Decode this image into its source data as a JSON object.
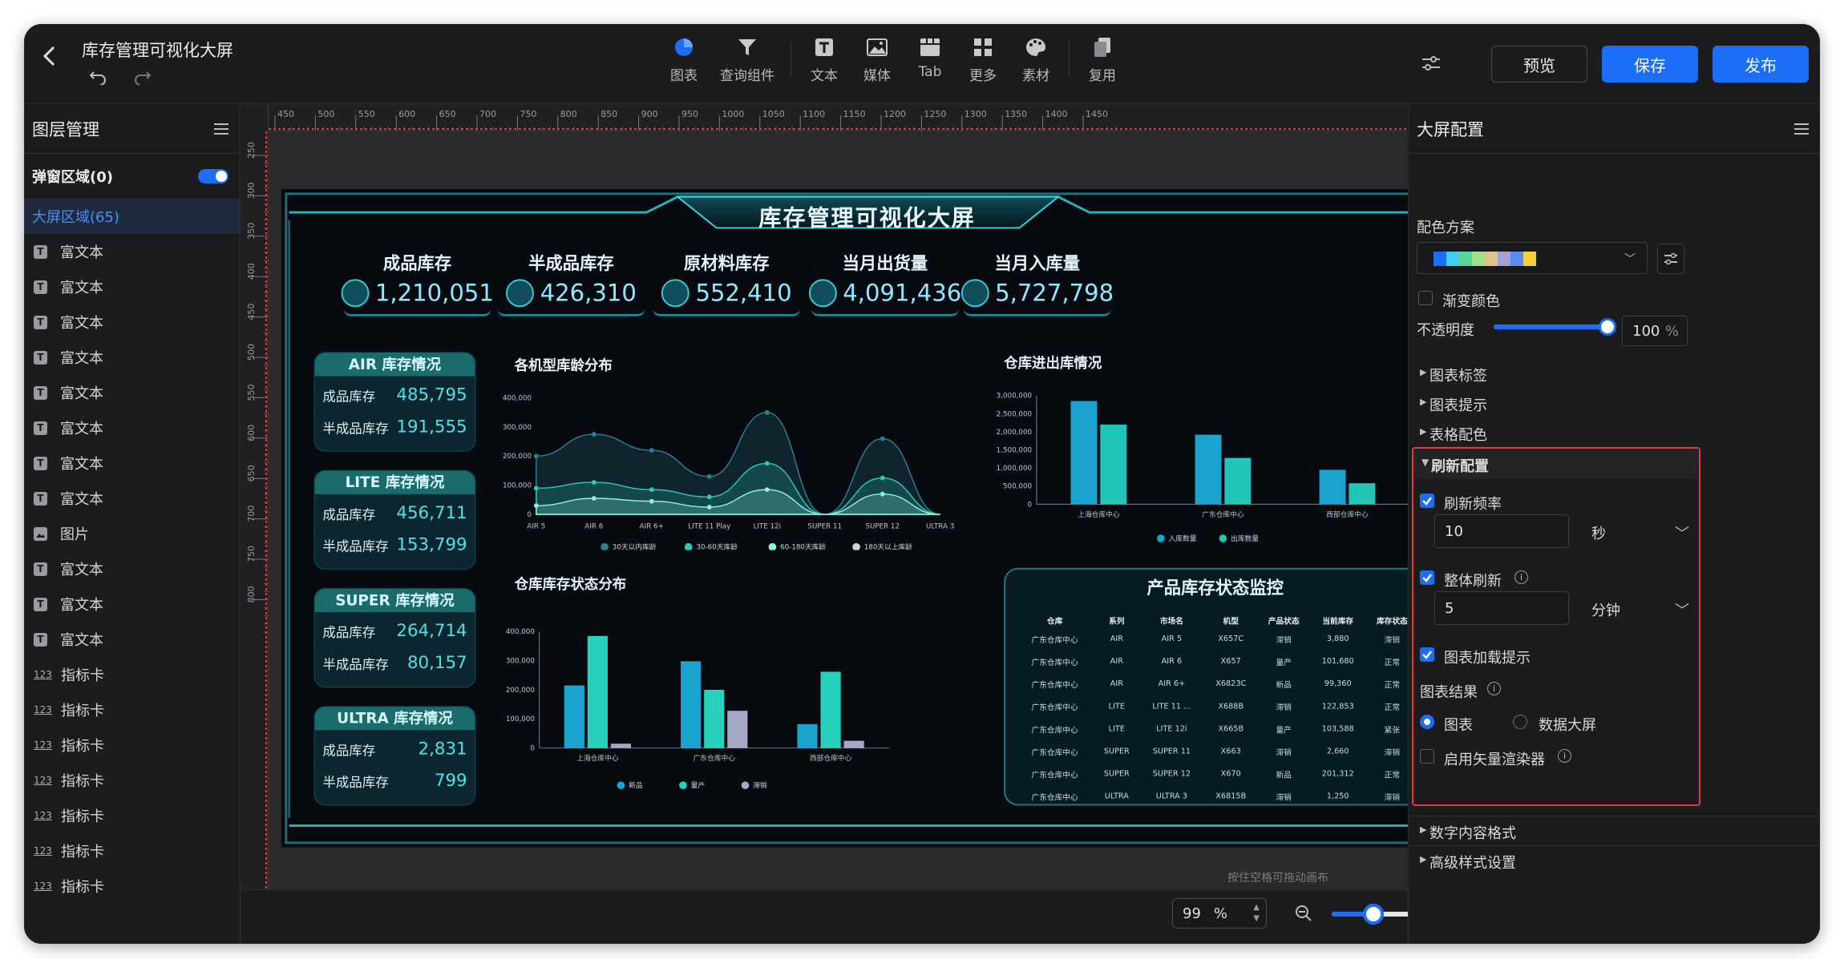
{
  "header": {
    "title": "库存管理可视化大屏",
    "tools": [
      {
        "label": "图表",
        "icon": "pie-chart-icon"
      },
      {
        "label": "查询组件",
        "icon": "filter-icon"
      },
      {
        "label": "文本",
        "icon": "text-icon"
      },
      {
        "label": "媒体",
        "icon": "image-icon"
      },
      {
        "label": "Tab",
        "icon": "tab-icon"
      },
      {
        "label": "更多",
        "icon": "grid-icon"
      },
      {
        "label": "素材",
        "icon": "palette-icon"
      },
      {
        "label": "复用",
        "icon": "copy-icon"
      }
    ],
    "preview": "预览",
    "save": "保存",
    "publish": "发布"
  },
  "layers": {
    "title": "图层管理",
    "popup": "弹窗区域(0)",
    "screen": "大屏区域(65)",
    "items": [
      {
        "type": "text",
        "label": "富文本"
      },
      {
        "type": "text",
        "label": "富文本"
      },
      {
        "type": "text",
        "label": "富文本"
      },
      {
        "type": "text",
        "label": "富文本"
      },
      {
        "type": "text",
        "label": "富文本"
      },
      {
        "type": "text",
        "label": "富文本"
      },
      {
        "type": "text",
        "label": "富文本"
      },
      {
        "type": "text",
        "label": "富文本"
      },
      {
        "type": "image",
        "label": "图片"
      },
      {
        "type": "text",
        "label": "富文本"
      },
      {
        "type": "text",
        "label": "富文本"
      },
      {
        "type": "text",
        "label": "富文本"
      },
      {
        "type": "kpi",
        "label": "指标卡"
      },
      {
        "type": "kpi",
        "label": "指标卡"
      },
      {
        "type": "kpi",
        "label": "指标卡"
      },
      {
        "type": "kpi",
        "label": "指标卡"
      },
      {
        "type": "kpi",
        "label": "指标卡"
      },
      {
        "type": "kpi",
        "label": "指标卡"
      },
      {
        "type": "kpi",
        "label": "指标卡"
      }
    ]
  },
  "ruler": {
    "h": [
      "450",
      "500",
      "550",
      "600",
      "650",
      "700",
      "750",
      "800",
      "850",
      "900",
      "950",
      "1000",
      "1050",
      "1100",
      "1150",
      "1200",
      "1250",
      "1300",
      "1350",
      "1400",
      "1450"
    ],
    "v": [
      "250",
      "300",
      "350",
      "400",
      "450",
      "500",
      "550",
      "600",
      "650",
      "700",
      "750",
      "800"
    ]
  },
  "screen": {
    "title": "库存管理可视化大屏",
    "kpis": [
      {
        "label": "成品库存",
        "value": "1,210,051"
      },
      {
        "label": "半成品库存",
        "value": "426,310"
      },
      {
        "label": "原材料库存",
        "value": "552,410"
      },
      {
        "label": "当月出货量",
        "value": "4,091,436"
      },
      {
        "label": "当月入库量",
        "value": "5,727,798"
      }
    ],
    "cards": [
      {
        "title": "AIR 库存情况",
        "r1": "成品库存",
        "v1": "485,795",
        "r2": "半成品库存",
        "v2": "191,555"
      },
      {
        "title": "LITE 库存情况",
        "r1": "成品库存",
        "v1": "456,711",
        "r2": "半成品库存",
        "v2": "153,799"
      },
      {
        "title": "SUPER 库存情况",
        "r1": "成品库存",
        "v1": "264,714",
        "r2": "半成品库存",
        "v2": "80,157"
      },
      {
        "title": "ULTRA 库存情况",
        "r1": "成品库存",
        "v1": "2,831",
        "r2": "半成品库存",
        "v2": "799"
      }
    ],
    "sections": {
      "age": "各机型库龄分布",
      "flow": "仓库进出库情况",
      "status": "仓库库存状态分布",
      "monitor": "产品库存状态监控"
    },
    "table": {
      "headers": [
        "仓库",
        "系列",
        "市场名",
        "机型",
        "产品状态",
        "当前库存",
        "库存状态"
      ],
      "rows": [
        [
          "广东仓库中心",
          "AIR",
          "AIR 5",
          "X657C",
          "滞销",
          "3,880",
          "滞销"
        ],
        [
          "广东仓库中心",
          "AIR",
          "AIR 6",
          "X657",
          "量产",
          "101,680",
          "正常"
        ],
        [
          "广东仓库中心",
          "AIR",
          "AIR 6+",
          "X6823C",
          "新品",
          "99,360",
          "正常"
        ],
        [
          "广东仓库中心",
          "LITE",
          "LITE 11 ...",
          "X688B",
          "滞销",
          "122,853",
          "正常"
        ],
        [
          "广东仓库中心",
          "LITE",
          "LITE 12i",
          "X665B",
          "量产",
          "103,588",
          "紧张"
        ],
        [
          "广东仓库中心",
          "SUPER",
          "SUPER 11",
          "X663",
          "滞销",
          "2,660",
          "滞销"
        ],
        [
          "广东仓库中心",
          "SUPER",
          "SUPER 12",
          "X670",
          "新品",
          "201,312",
          "正常"
        ],
        [
          "广东仓库中心",
          "ULTRA",
          "ULTRA 3",
          "X6815B",
          "滞销",
          "1,250",
          "滞销"
        ]
      ]
    },
    "hint": "按住空格可拖动画布"
  },
  "chart_data": [
    {
      "type": "area",
      "title": "各机型库龄分布",
      "categories": [
        "AIR 5",
        "AIR 6",
        "AIR 6+",
        "LITE 11 Play",
        "LITE 12i",
        "SUPER 11",
        "SUPER 12",
        "ULTRA 3"
      ],
      "ylim": [
        0,
        400000
      ],
      "yticks": [
        "400,000",
        "300,000",
        "200,000",
        "100,000",
        "0"
      ],
      "series": [
        {
          "name": "30天以内库龄",
          "color": "#2d7f95",
          "values": [
            200000,
            275000,
            220000,
            130000,
            350000,
            0,
            260000,
            0
          ]
        },
        {
          "name": "30-60天库龄",
          "color": "#2ec9b7",
          "values": [
            90000,
            110000,
            85000,
            60000,
            175000,
            0,
            125000,
            0
          ]
        },
        {
          "name": "60-180天库龄",
          "color": "#8ff0dd",
          "values": [
            30000,
            55000,
            45000,
            25000,
            85000,
            0,
            70000,
            0
          ]
        },
        {
          "name": "180天以上库龄",
          "color": "#c6d6da",
          "values": [
            0,
            0,
            0,
            0,
            0,
            0,
            0,
            0
          ]
        }
      ]
    },
    {
      "type": "bar",
      "title": "仓库进出库情况",
      "categories": [
        "上海仓库中心",
        "广东仓库中心",
        "西部仓库中心"
      ],
      "ylim": [
        0,
        3000000
      ],
      "yticks": [
        "3,000,000",
        "2,500,000",
        "2,000,000",
        "1,500,000",
        "1,000,000",
        "500,000",
        "0"
      ],
      "series": [
        {
          "name": "入库数量",
          "color": "#1aa3cf",
          "values": [
            2850000,
            1920000,
            950000
          ]
        },
        {
          "name": "出库数量",
          "color": "#21c6b9",
          "values": [
            2200000,
            1280000,
            580000
          ]
        }
      ]
    },
    {
      "type": "bar",
      "title": "仓库库存状态分布",
      "categories": [
        "上海仓库中心",
        "广东仓库中心",
        "西部仓库中心"
      ],
      "ylim": [
        0,
        400000
      ],
      "yticks": [
        "400,000",
        "300,000",
        "200,000",
        "100,000",
        "0"
      ],
      "series": [
        {
          "name": "新品",
          "color": "#1aa3cf",
          "values": [
            215000,
            298000,
            82000
          ]
        },
        {
          "name": "量产",
          "color": "#27d1bd",
          "values": [
            385000,
            200000,
            262000
          ]
        },
        {
          "name": "滞销",
          "color": "#a3a8c4",
          "values": [
            15000,
            128000,
            25000
          ]
        }
      ]
    }
  ],
  "config": {
    "title": "大屏配置",
    "color_scheme_label": "配色方案",
    "swatches": [
      "#1b6ef5",
      "#3fd0f0",
      "#59d49a",
      "#9fe08a",
      "#e0c48a",
      "#a7a0d8",
      "#5a8cf0",
      "#f2d23a"
    ],
    "gradient_label": "渐变颜色",
    "opacity_label": "不透明度",
    "opacity_value": "100",
    "opacity_unit": "%",
    "opacity_fraction": 1.0,
    "groups": [
      "图表标签",
      "图表提示",
      "表格配色"
    ],
    "refresh": {
      "title": "刷新配置",
      "freq_label": "刷新频率",
      "freq_value": "10",
      "freq_unit": "秒",
      "whole_label": "整体刷新",
      "whole_value": "5",
      "whole_unit": "分钟",
      "loading_label": "图表加载提示",
      "result_label": "图表结果",
      "opt_chart": "图表",
      "opt_screen": "数据大屏",
      "vector_label": "启用矢量渲染器"
    },
    "more_groups": [
      "数字内容格式",
      "高级样式设置"
    ]
  },
  "zoom": {
    "value": "99",
    "unit": "%",
    "fraction": 0.4
  }
}
